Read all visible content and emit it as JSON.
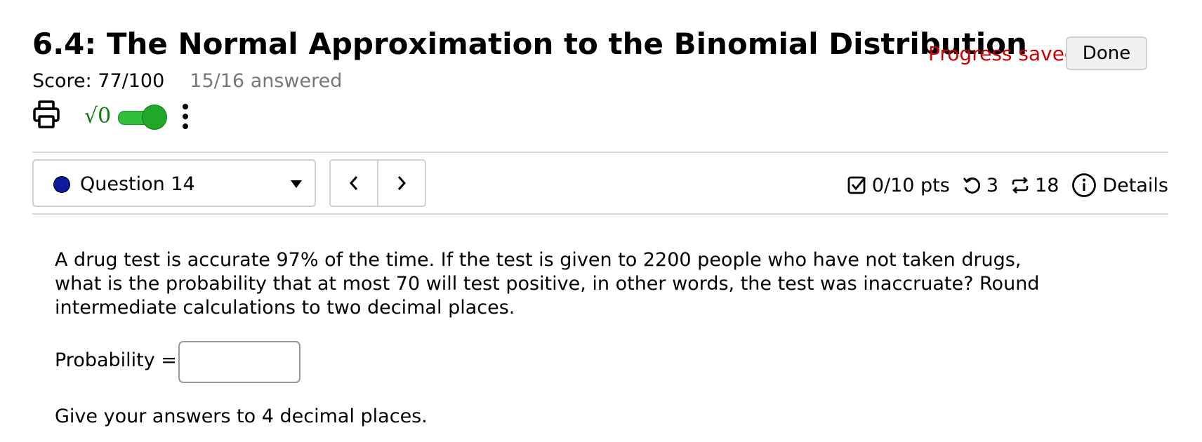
{
  "header": {
    "title": "6.4: The Normal Approximation to the Binomial Distribution",
    "progress_status": "Progress saved",
    "done_label": "Done",
    "score": "Score: 77/100",
    "answered": "15/16 answered"
  },
  "toolbar": {
    "print_icon": "printer-icon",
    "math_toggle_label": "√0",
    "math_toggle_on": true,
    "more_icon": "kebab-menu-icon"
  },
  "question_nav": {
    "selected_question": "Question 14",
    "prev_icon": "chevron-left-icon",
    "next_icon": "chevron-right-icon"
  },
  "question_meta": {
    "points": "0/10 pts",
    "retries": "3",
    "attempts": "18",
    "details_label": "Details"
  },
  "question": {
    "text": "A drug test is accurate 97% of the time.  If the test is given to 2200 people who have not taken drugs, what is the probability that at most 70 will test positive, in other words, the test was inaccruate? Round intermediate calculations to two decimal places.",
    "answer_label": "Probability =",
    "answer_value": "",
    "footer_note": "Give your answers to 4 decimal places."
  },
  "colors": {
    "progress_saved": "#cc0000",
    "toggle_green": "#1fa82a",
    "question_dot": "#0b1a9e",
    "muted_text": "#777777"
  }
}
